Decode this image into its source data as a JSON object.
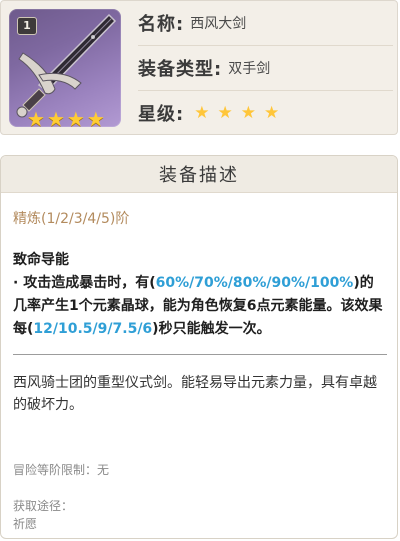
{
  "weapon": {
    "refinement_badge": "1",
    "rarity_stars": [
      "★",
      "★",
      "★",
      "★"
    ],
    "frame_color": "#7f69a1",
    "star_color": "#ffcc33"
  },
  "info": {
    "name_label": "名称:",
    "name_value": "西风大剑",
    "type_label": "装备类型:",
    "type_value": "双手剑",
    "grade_label": "星级:",
    "grade_stars": [
      "★",
      "★",
      "★",
      "★"
    ]
  },
  "description": {
    "header": "装备描述",
    "refinement": "精炼(1/2/3/4/5)阶",
    "effect_title": "致命导能",
    "effect_parts": {
      "p1": "· 攻击造成暴击时，有(",
      "h1": "60%/70%/80%/90%/100%",
      "p2": ")的几率产生1个元素晶球，能为角色恢复6点元素能量。该效果每(",
      "h2": "12/10.5/9/7.5/6",
      "p3": ")秒只能触发一次。"
    },
    "highlight_color": "#2f9fd6",
    "flavor": "西风骑士团的重型仪式剑。能轻易导出元素力量，具有卓越的破坏力。",
    "ascension_limit": "冒险等阶限制：无",
    "obtain_label": "获取途径：",
    "obtain_value": "祈愿"
  }
}
